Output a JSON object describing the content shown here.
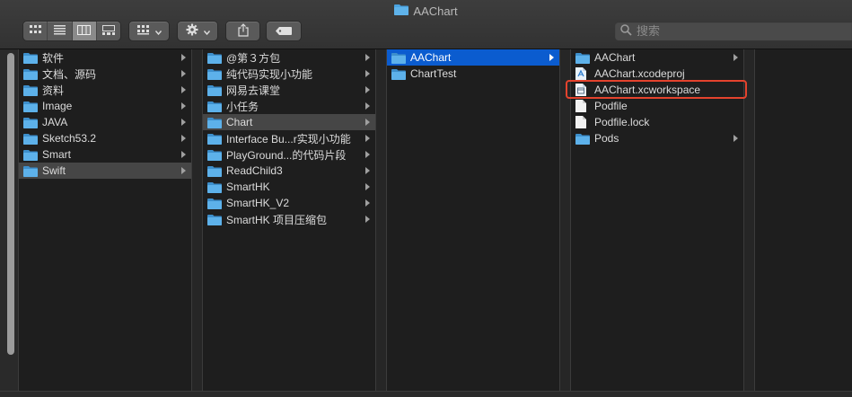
{
  "window": {
    "title": "AAChart"
  },
  "toolbar": {
    "view_buttons": [
      "icon-view-icon",
      "list-view-icon",
      "column-view-icon",
      "gallery-view-icon"
    ],
    "active_view": "column-view-icon"
  },
  "search": {
    "placeholder": "搜索"
  },
  "columns": [
    {
      "items": [
        {
          "label": "软件",
          "type": "folder",
          "arrow": true
        },
        {
          "label": "文档、源码",
          "type": "folder",
          "arrow": true
        },
        {
          "label": "资料",
          "type": "folder",
          "arrow": true
        },
        {
          "label": "Image",
          "type": "folder",
          "arrow": true
        },
        {
          "label": "JAVA",
          "type": "folder",
          "arrow": true
        },
        {
          "label": "Sketch53.2",
          "type": "folder",
          "arrow": true
        },
        {
          "label": "Smart",
          "type": "folder",
          "arrow": true
        },
        {
          "label": "Swift",
          "type": "folder",
          "arrow": true,
          "selected": "gray"
        }
      ]
    },
    {
      "items": [
        {
          "label": "@第３方包",
          "type": "folder",
          "arrow": true
        },
        {
          "label": "纯代码实现小功能",
          "type": "folder",
          "arrow": true
        },
        {
          "label": "网易去课堂",
          "type": "folder",
          "arrow": true
        },
        {
          "label": "小任务",
          "type": "folder",
          "arrow": true
        },
        {
          "label": "Chart",
          "type": "folder",
          "arrow": true,
          "selected": "gray"
        },
        {
          "label": "Interface Bu...r实现小功能",
          "type": "folder",
          "arrow": true
        },
        {
          "label": "PlayGround...的代码片段",
          "type": "folder",
          "arrow": true
        },
        {
          "label": "ReadChild3",
          "type": "folder",
          "arrow": true
        },
        {
          "label": "SmartHK",
          "type": "folder",
          "arrow": true
        },
        {
          "label": "SmartHK_V2",
          "type": "folder",
          "arrow": true
        },
        {
          "label": "SmartHK 项目压缩包",
          "type": "folder",
          "arrow": true
        }
      ]
    },
    {
      "items": [
        {
          "label": "AAChart",
          "type": "folder",
          "arrow": true,
          "selected": "blue"
        },
        {
          "label": "ChartTest",
          "type": "folder",
          "arrow": false
        }
      ]
    },
    {
      "items": [
        {
          "label": "AAChart",
          "type": "folder",
          "arrow": true
        },
        {
          "label": "AAChart.xcodeproj",
          "type": "xcodeproj",
          "arrow": false
        },
        {
          "label": "AAChart.xcworkspace",
          "type": "xcworkspace",
          "arrow": false,
          "highlighted": true
        },
        {
          "label": "Podfile",
          "type": "file",
          "arrow": false
        },
        {
          "label": "Podfile.lock",
          "type": "file",
          "arrow": false
        },
        {
          "label": "Pods",
          "type": "folder",
          "arrow": true
        }
      ]
    }
  ],
  "colors": {
    "folder": "#4aa3e0",
    "selection_blue": "#0b5ccf",
    "selection_gray": "#464646",
    "highlight_box": "#e4432d"
  }
}
